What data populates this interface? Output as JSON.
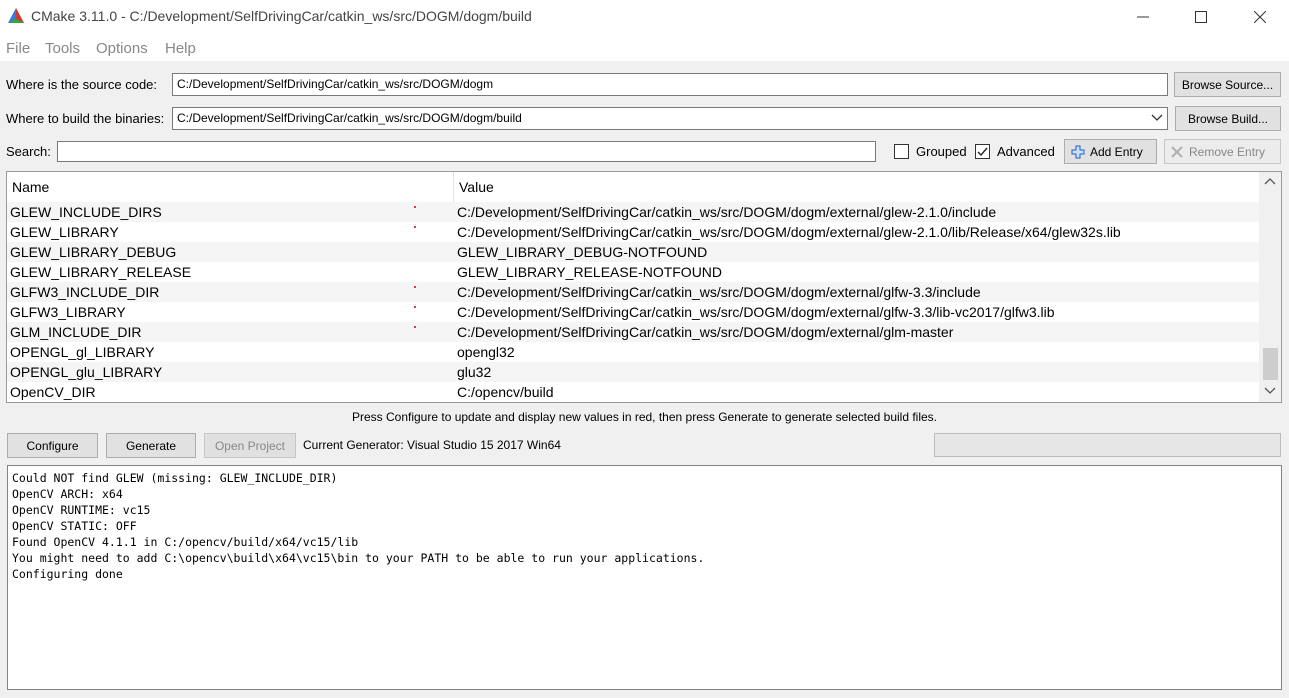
{
  "window": {
    "title": "CMake 3.11.0 - C:/Development/SelfDrivingCar/catkin_ws/src/DOGM/dogm/build",
    "minimize_glyph": "─",
    "maximize_glyph": "☐",
    "close_glyph": "✕"
  },
  "menu": {
    "file": "File",
    "tools": "Tools",
    "options": "Options",
    "help": "Help"
  },
  "source": {
    "label": "Where is the source code:",
    "value": "C:/Development/SelfDrivingCar/catkin_ws/src/DOGM/dogm",
    "browse_label": "Browse Source..."
  },
  "build": {
    "label": "Where to build the binaries:",
    "value": "C:/Development/SelfDrivingCar/catkin_ws/src/DOGM/dogm/build",
    "browse_label": "Browse Build..."
  },
  "search": {
    "label": "Search:",
    "value": "",
    "grouped_label": "Grouped",
    "grouped_checked": false,
    "advanced_label": "Advanced",
    "advanced_checked": true,
    "add_entry_label": "Add Entry",
    "remove_entry_label": "Remove Entry"
  },
  "table": {
    "headers": {
      "name": "Name",
      "value": "Value"
    },
    "rows": [
      {
        "name": "GLEW_INCLUDE_DIRS",
        "value": "C:/Development/SelfDrivingCar/catkin_ws/src/DOGM/dogm/external/glew-2.1.0/include"
      },
      {
        "name": "GLEW_LIBRARY",
        "value": "C:/Development/SelfDrivingCar/catkin_ws/src/DOGM/dogm/external/glew-2.1.0/lib/Release/x64/glew32s.lib"
      },
      {
        "name": "GLEW_LIBRARY_DEBUG",
        "value": "GLEW_LIBRARY_DEBUG-NOTFOUND"
      },
      {
        "name": "GLEW_LIBRARY_RELEASE",
        "value": "GLEW_LIBRARY_RELEASE-NOTFOUND"
      },
      {
        "name": "GLFW3_INCLUDE_DIR",
        "value": "C:/Development/SelfDrivingCar/catkin_ws/src/DOGM/dogm/external/glfw-3.3/include"
      },
      {
        "name": "GLFW3_LIBRARY",
        "value": "C:/Development/SelfDrivingCar/catkin_ws/src/DOGM/dogm/external/glfw-3.3/lib-vc2017/glfw3.lib"
      },
      {
        "name": "GLM_INCLUDE_DIR",
        "value": "C:/Development/SelfDrivingCar/catkin_ws/src/DOGM/dogm/external/glm-master"
      },
      {
        "name": "OPENGL_gl_LIBRARY",
        "value": "opengl32"
      },
      {
        "name": "OPENGL_glu_LIBRARY",
        "value": "glu32"
      },
      {
        "name": "OpenCV_DIR",
        "value": "C:/opencv/build"
      }
    ],
    "scroll_up_glyph": "︿",
    "scroll_down_glyph": "﹀"
  },
  "hint": "Press Configure to update and display new values in red, then press Generate to generate selected build files.",
  "actions": {
    "configure_label": "Configure",
    "generate_label": "Generate",
    "open_project_label": "Open Project",
    "generator_text": "Current Generator: Visual Studio 15 2017 Win64"
  },
  "output": {
    "lines": [
      "Could NOT find GLEW (missing: GLEW_INCLUDE_DIR)",
      "OpenCV ARCH: x64",
      "OpenCV RUNTIME: vc15",
      "OpenCV STATIC: OFF",
      "Found OpenCV 4.1.1 in C:/opencv/build/x64/vc15/lib",
      "You might need to add C:\\opencv\\build\\x64\\vc15\\bin to your PATH to be able to run your applications.",
      "Configuring done"
    ]
  },
  "colors": {
    "accent_blue": "#1a5fc7",
    "changed_marker": "#e53935"
  }
}
